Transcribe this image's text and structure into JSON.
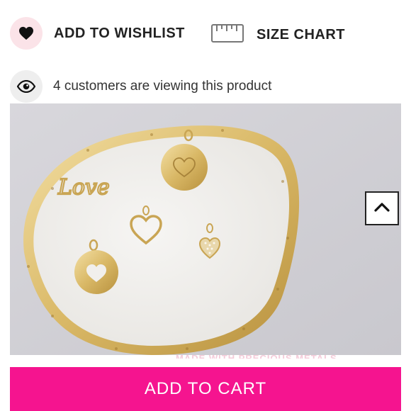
{
  "actions": {
    "wishlist_label": "ADD TO WISHLIST",
    "size_chart_label": "SIZE CHART"
  },
  "viewers": {
    "text": "4 customers are viewing this product"
  },
  "product_image": {
    "overlay_text": "MADE WITH PRECIOUS METALS",
    "charm_text": "Love"
  },
  "cart": {
    "button_label": "ADD TO CART"
  },
  "icons": {
    "wishlist": "heart-icon",
    "size_chart": "ruler-icon",
    "viewers": "eye-icon",
    "scroll_top": "chevron-up-icon"
  },
  "colors": {
    "accent": "#f5148f",
    "wishlist_bg": "#fbe3e8",
    "eye_bg": "#eeeeee"
  }
}
